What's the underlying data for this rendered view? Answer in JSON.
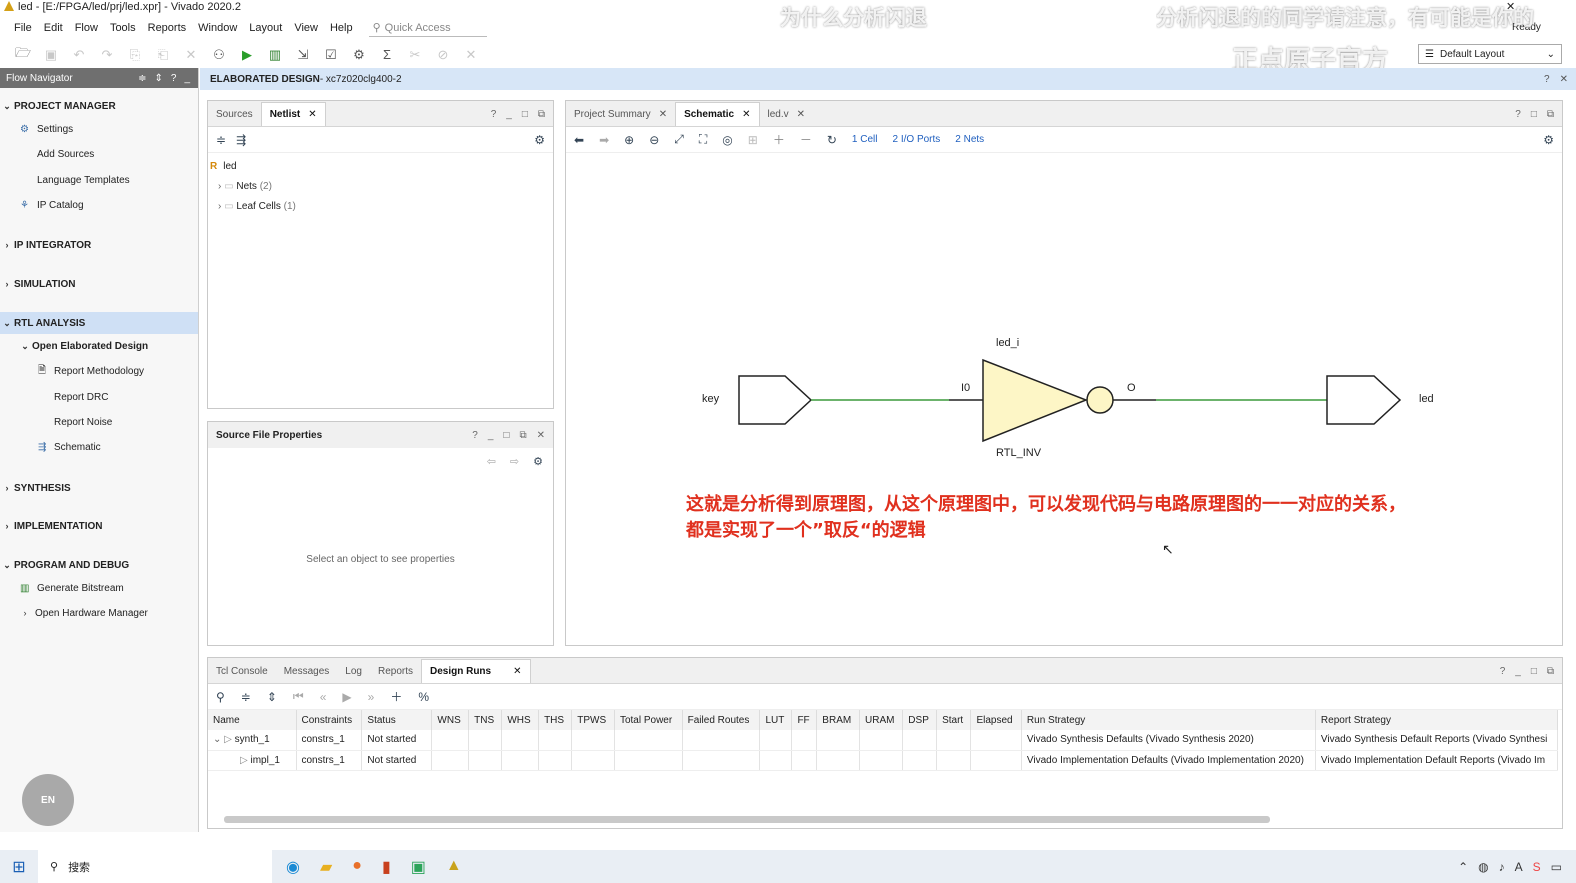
{
  "window": {
    "title": "led - [E:/FPGA/led/prj/led.xpr] - Vivado 2020.2",
    "status": "Ready",
    "layout": "Default Layout"
  },
  "menu": [
    "File",
    "Edit",
    "Flow",
    "Tools",
    "Reports",
    "Window",
    "Layout",
    "View",
    "Help"
  ],
  "quick_access": "Quick Access",
  "flow_navigator": {
    "title": "Flow Navigator",
    "project_manager": "PROJECT MANAGER",
    "settings": "Settings",
    "add_sources": "Add Sources",
    "language_templates": "Language Templates",
    "ip_catalog": "IP Catalog",
    "ip_integrator": "IP INTEGRATOR",
    "simulation": "SIMULATION",
    "rtl_analysis": "RTL ANALYSIS",
    "open_elaborated": "Open Elaborated Design",
    "report_methodology": "Report Methodology",
    "report_drc": "Report DRC",
    "report_noise": "Report Noise",
    "schematic": "Schematic",
    "synthesis": "SYNTHESIS",
    "implementation": "IMPLEMENTATION",
    "program_debug": "PROGRAM AND DEBUG",
    "generate_bitstream": "Generate Bitstream",
    "open_hw": "Open Hardware Manager"
  },
  "design_header": {
    "label": "ELABORATED DESIGN",
    "part": " - xc7z020clg400-2"
  },
  "netlist_panel": {
    "tab_sources": "Sources",
    "tab_netlist": "Netlist",
    "root": "led",
    "nets": "Nets",
    "nets_count": "(2)",
    "leaf": "Leaf Cells",
    "leaf_count": "(1)"
  },
  "props_panel": {
    "title": "Source File Properties",
    "empty": "Select an object to see properties"
  },
  "schematic_panel": {
    "tab_summary": "Project Summary",
    "tab_schematic": "Schematic",
    "tab_ledv": "led.v",
    "cells": "1 Cell",
    "ports": "2 I/O Ports",
    "nets": "2 Nets"
  },
  "schematic": {
    "input": "key",
    "output": "led",
    "cell": "led_i",
    "cell_type": "RTL_INV",
    "pin_in": "I0",
    "pin_out": "O"
  },
  "annotation": {
    "line1": "这就是分析得到原理图，从这个原理图中，可以发现代码与电路原理图的一一对应的关系，",
    "line2": "都是实现了一个”取反“的逻辑"
  },
  "overlay": {
    "top_center": "为什么分析闪退",
    "top_right": "分析闪退的的同学请注意，有可能是你的",
    "brand": "正点原子官方"
  },
  "bottom_panel": {
    "tabs": [
      "Tcl Console",
      "Messages",
      "Log",
      "Reports",
      "Design Runs"
    ],
    "columns": [
      "Name",
      "Constraints",
      "Status",
      "WNS",
      "TNS",
      "WHS",
      "THS",
      "TPWS",
      "Total Power",
      "Failed Routes",
      "LUT",
      "FF",
      "BRAM",
      "URAM",
      "DSP",
      "Start",
      "Elapsed",
      "Run Strategy",
      "Report Strategy"
    ],
    "rows": [
      {
        "name": "synth_1",
        "constraints": "constrs_1",
        "status": "Not started",
        "run": "Vivado Synthesis Defaults (Vivado Synthesis 2020)",
        "report": "Vivado Synthesis Default Reports (Vivado Synthesi"
      },
      {
        "name": "impl_1",
        "constraints": "constrs_1",
        "status": "Not started",
        "run": "Vivado Implementation Defaults (Vivado Implementation 2020)",
        "report": "Vivado Implementation Default Reports (Vivado Im"
      }
    ]
  },
  "taskbar": {
    "search": "搜索",
    "en": "EN"
  }
}
